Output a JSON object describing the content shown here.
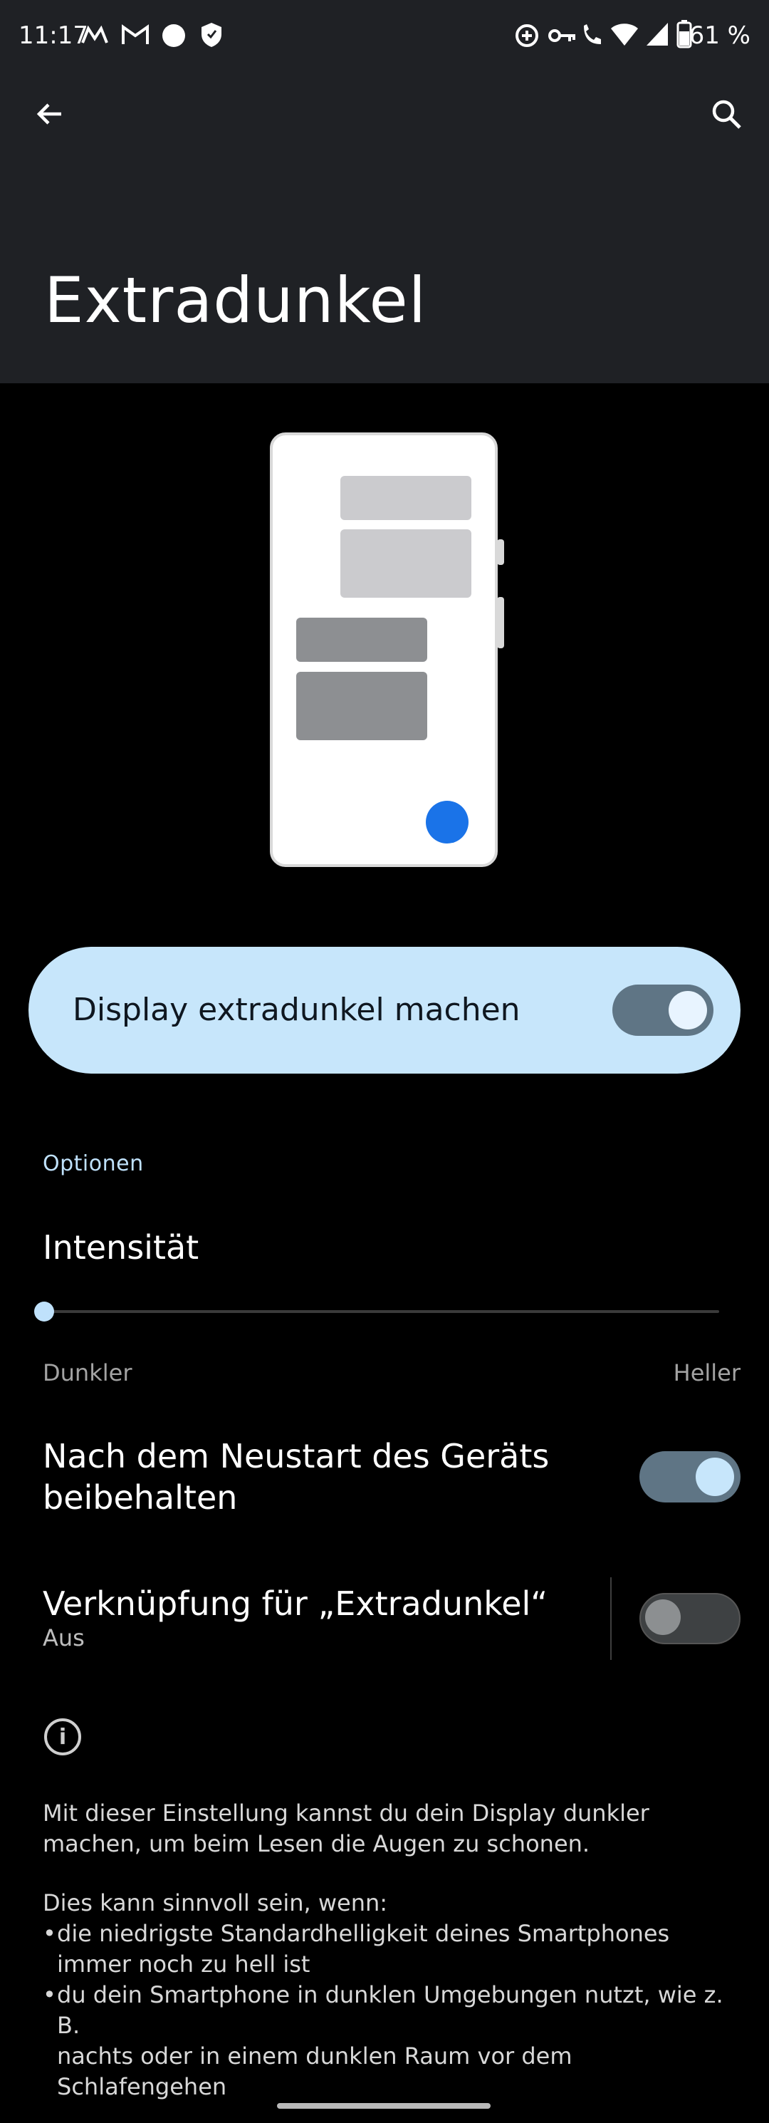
{
  "status_bar": {
    "time": "11:17",
    "battery": "61 %"
  },
  "app_bar": {
    "back_icon": "arrow-left-icon",
    "search_icon": "search-icon"
  },
  "page": {
    "title": "Extradunkel"
  },
  "main_toggle": {
    "label": "Display extradunkel machen",
    "on": true
  },
  "options": {
    "section_title": "Optionen",
    "intensity": {
      "label": "Intensität",
      "min_label": "Dunkler",
      "max_label": "Heller",
      "value": 0
    },
    "keep_after_restart": {
      "label_line1": "Nach dem Neustart des Geräts",
      "label_line2": "beibehalten",
      "on": true
    },
    "shortcut": {
      "label": "Verknüpfung für „Extradunkel“",
      "status": "Aus",
      "on": false
    }
  },
  "info": {
    "icon": "info-icon",
    "paragraph1_line1": "Mit dieser Einstellung kannst du dein Display dunkler",
    "paragraph1_line2": "machen, um beim Lesen die Augen zu schonen.",
    "paragraph2": "Dies kann sinnvoll sein, wenn:",
    "bullets": [
      {
        "line1": "die niedrigste Standardhelligkeit deines Smartphones",
        "line2": "immer noch zu hell ist"
      },
      {
        "line1": "du dein Smartphone in dunklen Umgebungen nutzt, wie z. B.",
        "line2": "nachts oder in einem dunklen Raum vor dem Schlafengehen"
      }
    ]
  },
  "colors": {
    "accent_light": "#c7e6fb",
    "fab_blue": "#1a73e8",
    "background": "#000000",
    "header_bg": "#1f2125"
  }
}
